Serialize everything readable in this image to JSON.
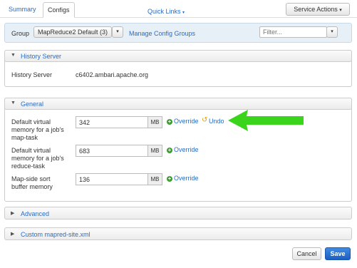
{
  "tabs": {
    "summary": "Summary",
    "configs": "Configs"
  },
  "quick_links": "Quick Links",
  "service_actions": "Service Actions",
  "group_bar": {
    "label": "Group",
    "selected": "MapReduce2 Default (3)",
    "manage_link": "Manage Config Groups",
    "filter_placeholder": "Filter..."
  },
  "history_server": {
    "title": "History Server",
    "label": "History Server",
    "value": "c6402.ambari.apache.org"
  },
  "general": {
    "title": "General",
    "rows": [
      {
        "label_lines": [
          "Default virtual",
          "memory for a job's",
          "map-task"
        ],
        "value": "342",
        "unit": "MB",
        "override": "Override",
        "undo": "Undo"
      },
      {
        "label_lines": [
          "Default virtual",
          "memory for a job's",
          "reduce-task"
        ],
        "value": "683",
        "unit": "MB",
        "override": "Override"
      },
      {
        "label_lines": [
          "Map-side sort",
          "buffer memory"
        ],
        "value": "136",
        "unit": "MB",
        "override": "Override"
      }
    ]
  },
  "advanced": {
    "title": "Advanced"
  },
  "custom": {
    "title": "Custom mapred-site.xml"
  },
  "buttons": {
    "cancel": "Cancel",
    "save": "Save"
  },
  "colors": {
    "link": "#2a6cc4",
    "arrow": "#3bd41d",
    "save": "#2a6cc4"
  }
}
